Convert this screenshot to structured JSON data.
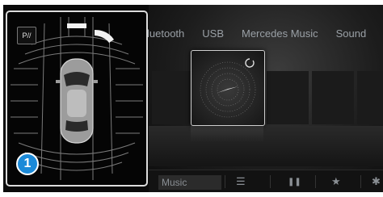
{
  "media_tabs": [
    "luetooth",
    "USB",
    "Mercedes Music",
    "Sound"
  ],
  "bottom_bar": {
    "music_label": "Music",
    "pause_icon": "pause-icon",
    "star_icon": "star-icon",
    "playlist_icon": "playlist-icon"
  },
  "parking": {
    "badge_label": "P//",
    "callout_number": "1"
  },
  "colors": {
    "callout_blue": "#1c8ad8",
    "panel_border": "#dcdcdc",
    "tab_text": "#9aa0a6"
  }
}
